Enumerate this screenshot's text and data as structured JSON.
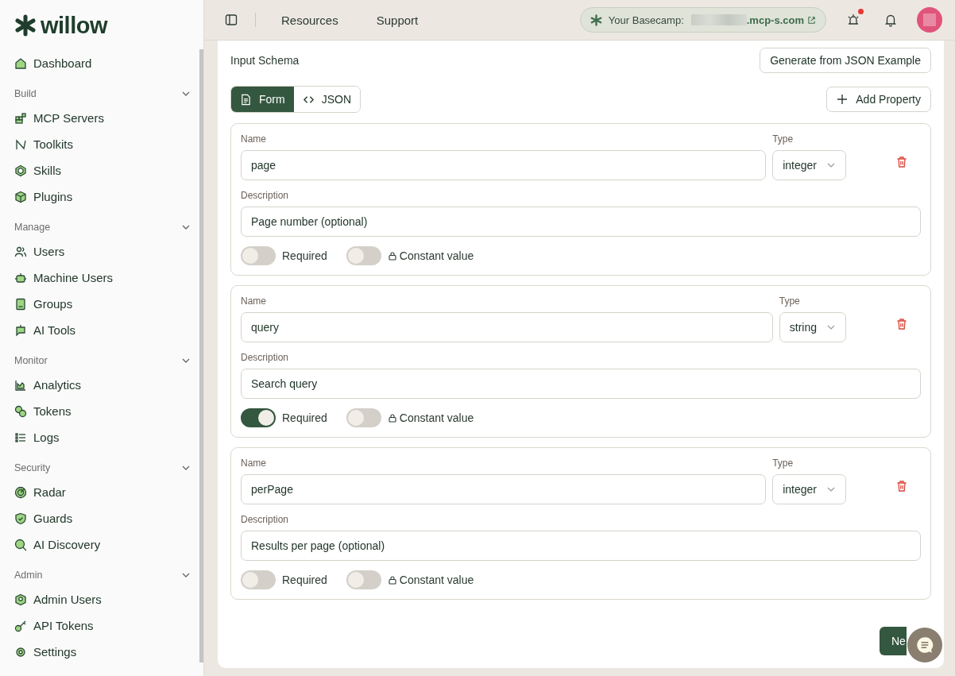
{
  "sidebar": {
    "logo": "willow",
    "top_item": {
      "label": "Dashboard"
    },
    "sections": [
      {
        "title": "Build",
        "expanded": true,
        "items": [
          {
            "label": "MCP Servers"
          },
          {
            "label": "Toolkits"
          },
          {
            "label": "Skills"
          },
          {
            "label": "Plugins"
          }
        ]
      },
      {
        "title": "Manage",
        "expanded": true,
        "items": [
          {
            "label": "Users"
          },
          {
            "label": "Machine Users"
          },
          {
            "label": "Groups"
          },
          {
            "label": "AI Tools"
          }
        ]
      },
      {
        "title": "Monitor",
        "expanded": true,
        "items": [
          {
            "label": "Analytics"
          },
          {
            "label": "Tokens"
          },
          {
            "label": "Logs"
          }
        ]
      },
      {
        "title": "Security",
        "expanded": true,
        "items": [
          {
            "label": "Radar"
          },
          {
            "label": "Guards"
          },
          {
            "label": "AI Discovery"
          }
        ]
      },
      {
        "title": "Admin",
        "expanded": true,
        "items": [
          {
            "label": "Admin Users"
          },
          {
            "label": "API Tokens"
          },
          {
            "label": "Settings"
          }
        ]
      }
    ]
  },
  "topbar": {
    "links": [
      "Resources",
      "Support"
    ],
    "basecamp_label": "Your Basecamp:",
    "basecamp_domain": ".mcp-s.com",
    "alert_badge": true
  },
  "schema": {
    "title": "Input Schema",
    "generate_button": "Generate from JSON Example",
    "tabs": [
      {
        "label": "Form",
        "selected": true
      },
      {
        "label": "JSON",
        "selected": false
      }
    ],
    "add_button": "Add Property",
    "properties": [
      {
        "name_label": "Name",
        "name": "page",
        "type_label": "Type",
        "type": "integer",
        "description_label": "Description",
        "description": "Page number (optional)",
        "required_label": "Required",
        "required": false,
        "constant_label": "Constant value",
        "constant": false
      },
      {
        "name_label": "Name",
        "name": "query",
        "type_label": "Type",
        "type": "string",
        "description_label": "Description",
        "description": "Search query",
        "required_label": "Required",
        "required": true,
        "constant_label": "Constant value",
        "constant": false
      },
      {
        "name_label": "Name",
        "name": "perPage",
        "type_label": "Type",
        "type": "integer",
        "description_label": "Description",
        "description": "Results per page (optional)",
        "required_label": "Required",
        "required": false,
        "constant_label": "Constant value",
        "constant": false
      }
    ],
    "next_button": "Ne"
  }
}
